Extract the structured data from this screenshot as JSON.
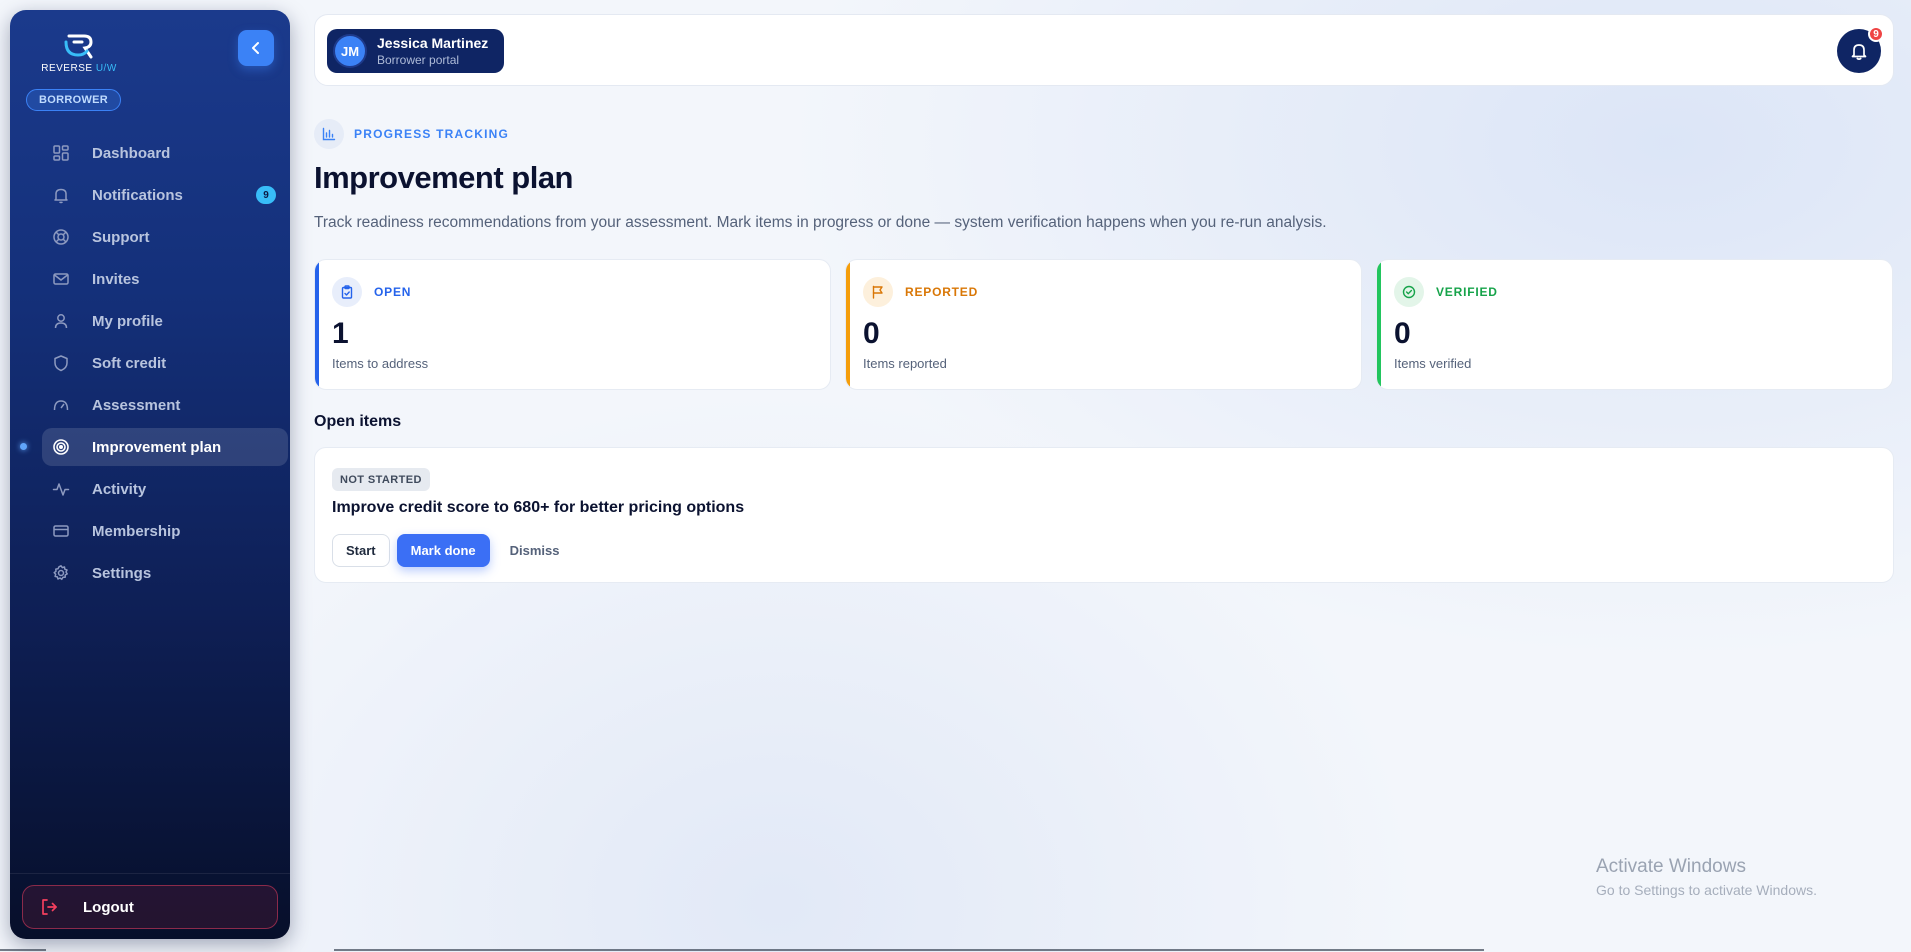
{
  "brand": {
    "logo_text": "REVERSE",
    "logo_text_accent": "U/W"
  },
  "sidebar": {
    "role_badge": "BORROWER",
    "items": [
      {
        "label": "Dashboard",
        "icon": "grid-icon"
      },
      {
        "label": "Notifications",
        "icon": "bell-icon",
        "count": "9"
      },
      {
        "label": "Support",
        "icon": "lifebuoy-icon"
      },
      {
        "label": "Invites",
        "icon": "mail-icon"
      },
      {
        "label": "My profile",
        "icon": "user-icon"
      },
      {
        "label": "Soft credit",
        "icon": "shield-icon"
      },
      {
        "label": "Assessment",
        "icon": "gauge-icon"
      },
      {
        "label": "Improvement plan",
        "icon": "target-icon",
        "active": true
      },
      {
        "label": "Activity",
        "icon": "activity-icon"
      },
      {
        "label": "Membership",
        "icon": "credit-card-icon"
      },
      {
        "label": "Settings",
        "icon": "gear-icon"
      }
    ],
    "logout_label": "Logout"
  },
  "header": {
    "user_initials": "JM",
    "user_name": "Jessica Martinez",
    "user_subtitle": "Borrower portal",
    "notification_count": "9"
  },
  "main": {
    "eyebrow": "PROGRESS TRACKING",
    "title": "Improvement plan",
    "description": "Track readiness recommendations from your assessment. Mark items in progress or done — system verification happens when you re-run analysis.",
    "stats": [
      {
        "label": "OPEN",
        "value": "1",
        "sub": "Items to address",
        "color": "#2563eb",
        "icon": "clipboard-check-icon"
      },
      {
        "label": "REPORTED",
        "value": "0",
        "sub": "Items reported",
        "color": "#d97706",
        "icon": "flag-icon"
      },
      {
        "label": "VERIFIED",
        "value": "0",
        "sub": "Items verified",
        "color": "#16a34a",
        "icon": "check-circle-icon"
      }
    ],
    "section_title": "Open items",
    "items": [
      {
        "status": "NOT STARTED",
        "title": "Improve credit score to 680+ for better pricing options",
        "actions": {
          "start": "Start",
          "mark_done": "Mark done",
          "dismiss": "Dismiss"
        }
      }
    ]
  },
  "os_watermark": {
    "title": "Activate Windows",
    "subtitle": "Go to Settings to activate Windows."
  },
  "colors": {
    "accent": "#3b82f6",
    "sidebar_top": "#1b3a8c",
    "sidebar_bottom": "#070f2a",
    "badge_red": "#ef4444"
  }
}
